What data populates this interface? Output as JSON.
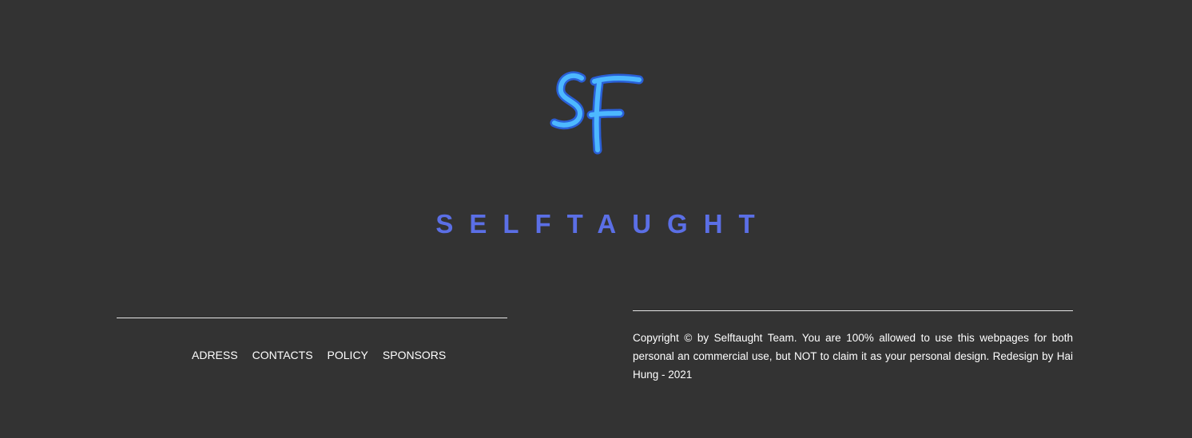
{
  "brand": {
    "logo_icon": "sf-monogram-logo",
    "logo_text": "SF",
    "name": "SELFTAUGHT",
    "color": "#5b6fe6",
    "logo_fill": "#4db8ff",
    "logo_outline": "#2a5fd6"
  },
  "nav": {
    "items": [
      "ADRESS",
      "CONTACTS",
      "POLICY",
      "SPONSORS"
    ]
  },
  "copyright": {
    "text": "Copyright © by Selftaught Team. You are 100% allowed to use this webpages for both personal an commercial use, but NOT to claim it as your personal design. Redesign by Hai Hung - 2021"
  },
  "colors": {
    "background": "#333333",
    "text": "#ffffff",
    "divider": "#e6e6e6"
  }
}
